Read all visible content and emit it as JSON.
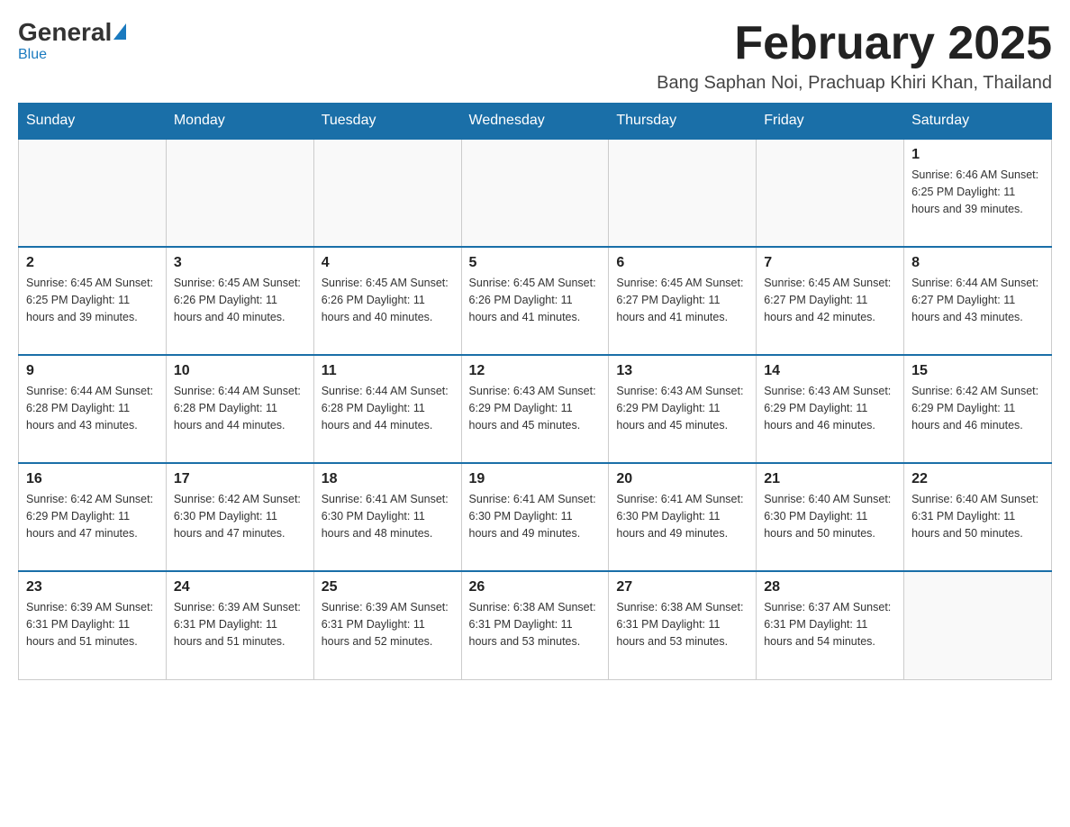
{
  "logo": {
    "general": "General",
    "blue": "Blue"
  },
  "header": {
    "title": "February 2025",
    "location": "Bang Saphan Noi, Prachuap Khiri Khan, Thailand"
  },
  "days_of_week": [
    "Sunday",
    "Monday",
    "Tuesday",
    "Wednesday",
    "Thursday",
    "Friday",
    "Saturday"
  ],
  "weeks": [
    [
      {
        "day": "",
        "info": ""
      },
      {
        "day": "",
        "info": ""
      },
      {
        "day": "",
        "info": ""
      },
      {
        "day": "",
        "info": ""
      },
      {
        "day": "",
        "info": ""
      },
      {
        "day": "",
        "info": ""
      },
      {
        "day": "1",
        "info": "Sunrise: 6:46 AM\nSunset: 6:25 PM\nDaylight: 11 hours and 39 minutes."
      }
    ],
    [
      {
        "day": "2",
        "info": "Sunrise: 6:45 AM\nSunset: 6:25 PM\nDaylight: 11 hours and 39 minutes."
      },
      {
        "day": "3",
        "info": "Sunrise: 6:45 AM\nSunset: 6:26 PM\nDaylight: 11 hours and 40 minutes."
      },
      {
        "day": "4",
        "info": "Sunrise: 6:45 AM\nSunset: 6:26 PM\nDaylight: 11 hours and 40 minutes."
      },
      {
        "day": "5",
        "info": "Sunrise: 6:45 AM\nSunset: 6:26 PM\nDaylight: 11 hours and 41 minutes."
      },
      {
        "day": "6",
        "info": "Sunrise: 6:45 AM\nSunset: 6:27 PM\nDaylight: 11 hours and 41 minutes."
      },
      {
        "day": "7",
        "info": "Sunrise: 6:45 AM\nSunset: 6:27 PM\nDaylight: 11 hours and 42 minutes."
      },
      {
        "day": "8",
        "info": "Sunrise: 6:44 AM\nSunset: 6:27 PM\nDaylight: 11 hours and 43 minutes."
      }
    ],
    [
      {
        "day": "9",
        "info": "Sunrise: 6:44 AM\nSunset: 6:28 PM\nDaylight: 11 hours and 43 minutes."
      },
      {
        "day": "10",
        "info": "Sunrise: 6:44 AM\nSunset: 6:28 PM\nDaylight: 11 hours and 44 minutes."
      },
      {
        "day": "11",
        "info": "Sunrise: 6:44 AM\nSunset: 6:28 PM\nDaylight: 11 hours and 44 minutes."
      },
      {
        "day": "12",
        "info": "Sunrise: 6:43 AM\nSunset: 6:29 PM\nDaylight: 11 hours and 45 minutes."
      },
      {
        "day": "13",
        "info": "Sunrise: 6:43 AM\nSunset: 6:29 PM\nDaylight: 11 hours and 45 minutes."
      },
      {
        "day": "14",
        "info": "Sunrise: 6:43 AM\nSunset: 6:29 PM\nDaylight: 11 hours and 46 minutes."
      },
      {
        "day": "15",
        "info": "Sunrise: 6:42 AM\nSunset: 6:29 PM\nDaylight: 11 hours and 46 minutes."
      }
    ],
    [
      {
        "day": "16",
        "info": "Sunrise: 6:42 AM\nSunset: 6:29 PM\nDaylight: 11 hours and 47 minutes."
      },
      {
        "day": "17",
        "info": "Sunrise: 6:42 AM\nSunset: 6:30 PM\nDaylight: 11 hours and 47 minutes."
      },
      {
        "day": "18",
        "info": "Sunrise: 6:41 AM\nSunset: 6:30 PM\nDaylight: 11 hours and 48 minutes."
      },
      {
        "day": "19",
        "info": "Sunrise: 6:41 AM\nSunset: 6:30 PM\nDaylight: 11 hours and 49 minutes."
      },
      {
        "day": "20",
        "info": "Sunrise: 6:41 AM\nSunset: 6:30 PM\nDaylight: 11 hours and 49 minutes."
      },
      {
        "day": "21",
        "info": "Sunrise: 6:40 AM\nSunset: 6:30 PM\nDaylight: 11 hours and 50 minutes."
      },
      {
        "day": "22",
        "info": "Sunrise: 6:40 AM\nSunset: 6:31 PM\nDaylight: 11 hours and 50 minutes."
      }
    ],
    [
      {
        "day": "23",
        "info": "Sunrise: 6:39 AM\nSunset: 6:31 PM\nDaylight: 11 hours and 51 minutes."
      },
      {
        "day": "24",
        "info": "Sunrise: 6:39 AM\nSunset: 6:31 PM\nDaylight: 11 hours and 51 minutes."
      },
      {
        "day": "25",
        "info": "Sunrise: 6:39 AM\nSunset: 6:31 PM\nDaylight: 11 hours and 52 minutes."
      },
      {
        "day": "26",
        "info": "Sunrise: 6:38 AM\nSunset: 6:31 PM\nDaylight: 11 hours and 53 minutes."
      },
      {
        "day": "27",
        "info": "Sunrise: 6:38 AM\nSunset: 6:31 PM\nDaylight: 11 hours and 53 minutes."
      },
      {
        "day": "28",
        "info": "Sunrise: 6:37 AM\nSunset: 6:31 PM\nDaylight: 11 hours and 54 minutes."
      },
      {
        "day": "",
        "info": ""
      }
    ]
  ]
}
